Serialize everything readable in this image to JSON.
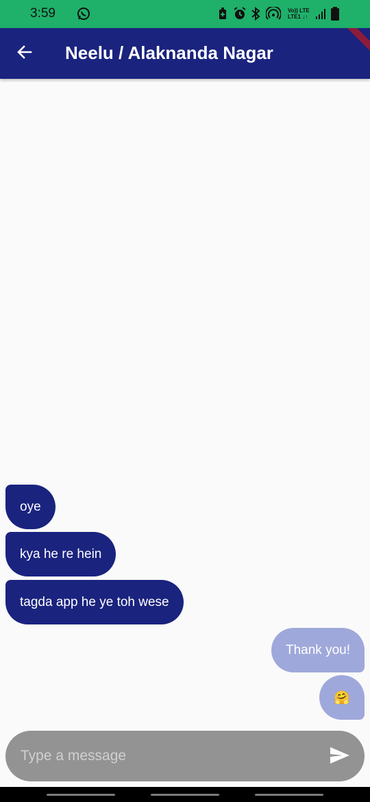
{
  "status_bar": {
    "time": "3:59",
    "network_top": "Vo)) LTE",
    "network_bottom": "LTE1 ↓↑",
    "icons": [
      "whatsapp-icon",
      "battery-saver-icon",
      "alarm-icon",
      "bluetooth-icon",
      "hotspot-icon",
      "signal-icon",
      "battery-icon"
    ]
  },
  "app_bar": {
    "title": "Neelu / Alaknanda Nagar",
    "back_icon": "arrow-back-icon",
    "background": "#1a237e"
  },
  "messages": [
    {
      "direction": "incoming",
      "text": "oye"
    },
    {
      "direction": "incoming",
      "text": "kya he re hein"
    },
    {
      "direction": "incoming",
      "text": "tagda app he ye toh wese"
    },
    {
      "direction": "outgoing",
      "text": "Thank you!"
    },
    {
      "direction": "outgoing",
      "text": "🤗"
    }
  ],
  "colors": {
    "incoming_bubble": "#1a237e",
    "outgoing_bubble": "#9fa8da",
    "status_bar": "#1fb06a",
    "composer": "#939393"
  },
  "composer": {
    "placeholder": "Type a message",
    "value": "",
    "send_icon": "send-icon"
  }
}
